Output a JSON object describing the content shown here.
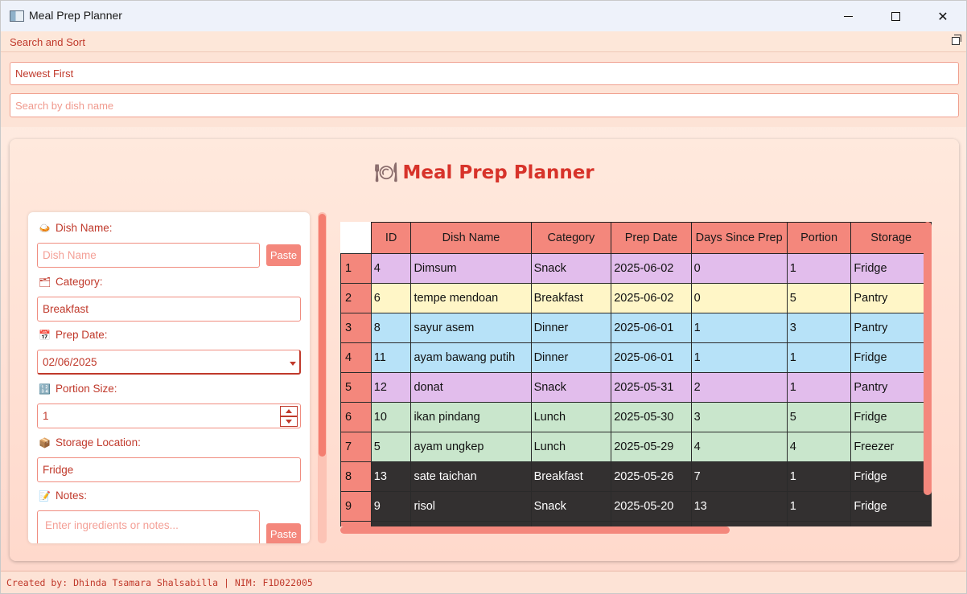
{
  "window": {
    "title": "Meal Prep Planner"
  },
  "dock": {
    "title": "Search and Sort",
    "sort_value": "Newest First",
    "search_placeholder": "Search by dish name"
  },
  "main": {
    "title": "Meal Prep Planner",
    "title_icon": "plate-icon"
  },
  "form": {
    "dish_name_label": "Dish Name:",
    "dish_name_placeholder": "Dish Name",
    "paste_label": "Paste",
    "category_label": "Category:",
    "category_value": "Breakfast",
    "prep_date_label": "Prep Date:",
    "prep_date_value": "02/06/2025",
    "portion_label": "Portion Size:",
    "portion_value": "1",
    "storage_label": "Storage Location:",
    "storage_value": "Fridge",
    "notes_label": "Notes:",
    "notes_placeholder": "Enter ingredients or notes...",
    "notes_paste_label": "Paste"
  },
  "table": {
    "columns": [
      "ID",
      "Dish Name",
      "Category",
      "Prep Date",
      "Days Since Prep",
      "Portion",
      "Storage"
    ],
    "rows": [
      {
        "n": "1",
        "id": "4",
        "dish": "Dimsum",
        "category": "Snack",
        "date": "2025-06-02",
        "days": "0",
        "portion": "1",
        "storage": "Fridge",
        "style": "snack"
      },
      {
        "n": "2",
        "id": "6",
        "dish": "tempe mendoan",
        "category": "Breakfast",
        "date": "2025-06-02",
        "days": "0",
        "portion": "5",
        "storage": "Pantry",
        "style": "breakfast"
      },
      {
        "n": "3",
        "id": "8",
        "dish": "sayur asem",
        "category": "Dinner",
        "date": "2025-06-01",
        "days": "1",
        "portion": "3",
        "storage": "Pantry",
        "style": "dinner"
      },
      {
        "n": "4",
        "id": "11",
        "dish": "ayam bawang putih",
        "category": "Dinner",
        "date": "2025-06-01",
        "days": "1",
        "portion": "1",
        "storage": "Fridge",
        "style": "dinner"
      },
      {
        "n": "5",
        "id": "12",
        "dish": "donat",
        "category": "Snack",
        "date": "2025-05-31",
        "days": "2",
        "portion": "1",
        "storage": "Pantry",
        "style": "snack"
      },
      {
        "n": "6",
        "id": "10",
        "dish": "ikan pindang",
        "category": "Lunch",
        "date": "2025-05-30",
        "days": "3",
        "portion": "5",
        "storage": "Fridge",
        "style": "lunch"
      },
      {
        "n": "7",
        "id": "5",
        "dish": "ayam ungkep",
        "category": "Lunch",
        "date": "2025-05-29",
        "days": "4",
        "portion": "4",
        "storage": "Freezer",
        "style": "lunch"
      },
      {
        "n": "8",
        "id": "13",
        "dish": "sate taichan",
        "category": "Breakfast",
        "date": "2025-05-26",
        "days": "7",
        "portion": "1",
        "storage": "Fridge",
        "style": "old"
      },
      {
        "n": "9",
        "id": "9",
        "dish": "risol",
        "category": "Snack",
        "date": "2025-05-20",
        "days": "13",
        "portion": "1",
        "storage": "Fridge",
        "style": "old"
      },
      {
        "n": "",
        "id": "",
        "dish": "",
        "category": "",
        "date": "",
        "days": "",
        "portion": "",
        "storage": "",
        "style": "old"
      }
    ]
  },
  "status": {
    "text": "Created by: Dhinda Tsamara Shalsabilla | NIM: F1D022005"
  },
  "colors": {
    "accent": "#f4877c",
    "title_red": "#d7332a",
    "label_red": "#c0392b",
    "snack": "#e2bdec",
    "breakfast": "#fff6c7",
    "dinner": "#b7e2f8",
    "lunch": "#c9e6cc",
    "old": "#333030"
  }
}
